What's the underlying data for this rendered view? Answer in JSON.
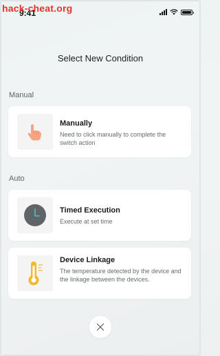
{
  "watermark": "hack-cheat.org",
  "status_bar": {
    "time": "9:41"
  },
  "header": {
    "title": "Select New Condition"
  },
  "sections": {
    "manual": {
      "label": "Manual",
      "cards": [
        {
          "title": "Manually",
          "description": "Need to click manually to complete the switch action",
          "icon": "tap-hand-icon"
        }
      ]
    },
    "auto": {
      "label": "Auto",
      "cards": [
        {
          "title": "Timed Execution",
          "description": "Execute at set time",
          "icon": "clock-icon"
        },
        {
          "title": "Device Linkage",
          "description": "The temperature detected by the device and the linkage between the devices.",
          "icon": "thermometer-icon"
        }
      ]
    }
  },
  "close_icon": "close-icon",
  "colors": {
    "clock": "#5f6468",
    "clock_hands": "#3ec7c4",
    "thermo": "#f2b92d",
    "hand": "#f5a583",
    "watermark": "#e2342f"
  }
}
